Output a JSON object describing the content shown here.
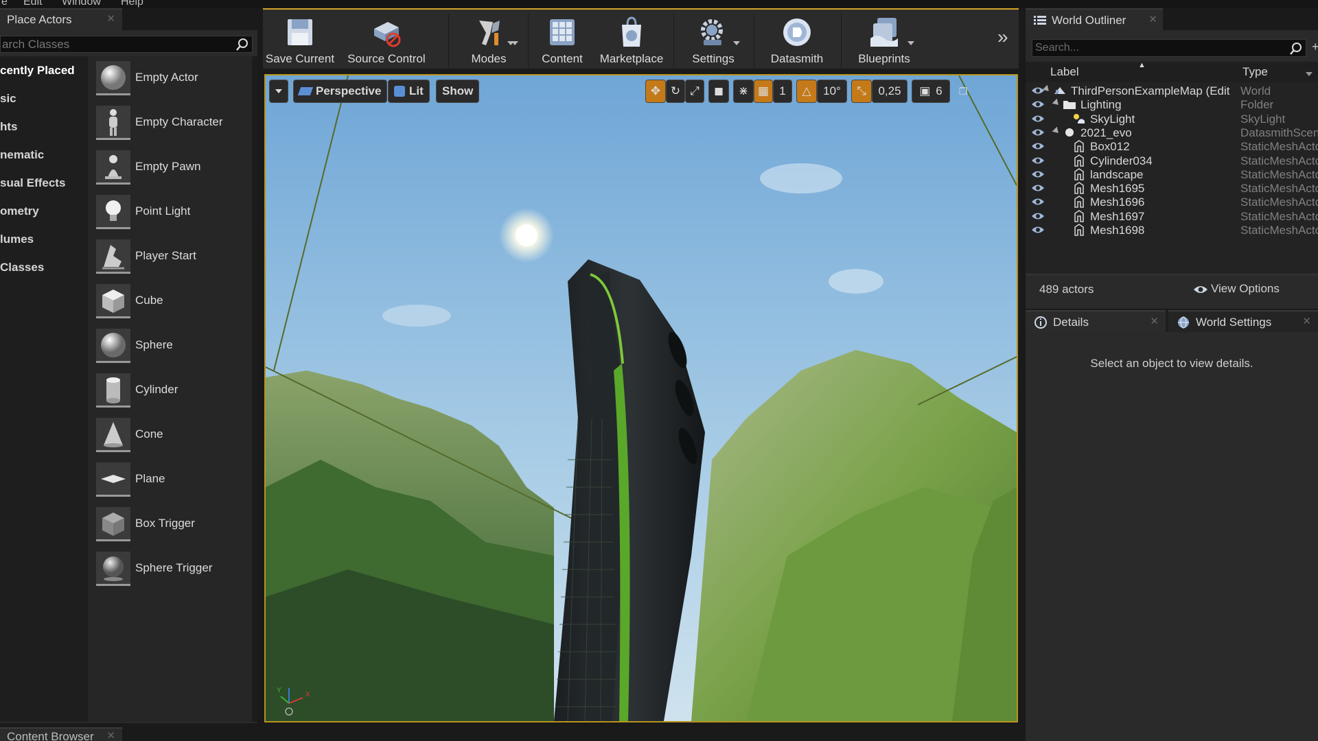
{
  "menu": [
    "e",
    "Edit",
    "Window",
    "Help"
  ],
  "place_actors": {
    "tab_title": "Place Actors",
    "search_placeholder": "arch Classes",
    "categories": [
      "cently Placed",
      "sic",
      "hts",
      "nematic",
      "sual Effects",
      "ometry",
      "lumes",
      "Classes"
    ],
    "items": [
      "Empty Actor",
      "Empty Character",
      "Empty Pawn",
      "Point Light",
      "Player Start",
      "Cube",
      "Sphere",
      "Cylinder",
      "Cone",
      "Plane",
      "Box Trigger",
      "Sphere Trigger"
    ]
  },
  "content_browser": {
    "tab_title": "Content Browser"
  },
  "toolbar": {
    "save_current": "Save Current",
    "source_control": "Source Control",
    "modes": "Modes",
    "content": "Content",
    "marketplace": "Marketplace",
    "settings": "Settings",
    "datasmith": "Datasmith",
    "blueprints": "Blueprints"
  },
  "viewport": {
    "perspective": "Perspective",
    "lit": "Lit",
    "show": "Show",
    "grid_snap": "1",
    "rotation_snap": "10°",
    "scale_snap": "0,25",
    "camera_speed": "6"
  },
  "world_outliner": {
    "tab_title": "World Outliner",
    "search_placeholder": "Search...",
    "col_label": "Label",
    "col_type": "Type",
    "rows": [
      {
        "label": "ThirdPersonExampleMap (Edit",
        "type": "World",
        "indent": 0,
        "icon": "world-icon",
        "expander": true
      },
      {
        "label": "Lighting",
        "type": "Folder",
        "indent": 1,
        "icon": "folder-icon",
        "expander": true
      },
      {
        "label": "SkyLight",
        "type": "SkyLight",
        "indent": 2,
        "icon": "skylight-icon",
        "expander": false
      },
      {
        "label": "2021_evo",
        "type": "DatasmithScen",
        "indent": 1,
        "icon": "sphere-icon",
        "expander": true
      },
      {
        "label": "Box012",
        "type": "StaticMeshActo",
        "indent": 2,
        "icon": "static-mesh-icon",
        "expander": false
      },
      {
        "label": "Cylinder034",
        "type": "StaticMeshActo",
        "indent": 2,
        "icon": "static-mesh-icon",
        "expander": false
      },
      {
        "label": "landscape",
        "type": "StaticMeshActo",
        "indent": 2,
        "icon": "static-mesh-icon",
        "expander": false
      },
      {
        "label": "Mesh1695",
        "type": "StaticMeshActo",
        "indent": 2,
        "icon": "static-mesh-icon",
        "expander": false
      },
      {
        "label": "Mesh1696",
        "type": "StaticMeshActo",
        "indent": 2,
        "icon": "static-mesh-icon",
        "expander": false
      },
      {
        "label": "Mesh1697",
        "type": "StaticMeshActo",
        "indent": 2,
        "icon": "static-mesh-icon",
        "expander": false
      },
      {
        "label": "Mesh1698",
        "type": "StaticMeshActo",
        "indent": 2,
        "icon": "static-mesh-icon",
        "expander": false
      }
    ],
    "actor_count": "489 actors",
    "view_options": "View Options"
  },
  "details": {
    "tab_details": "Details",
    "tab_world_settings": "World Settings",
    "empty_message": "Select an object to view details."
  },
  "colors": {
    "accent_orange": "#c47a18",
    "viewport_border": "#b8941e",
    "panel_bg": "#2a2a2a",
    "sky": "#7fb2d8",
    "grass_green": "#6f9a3a"
  }
}
